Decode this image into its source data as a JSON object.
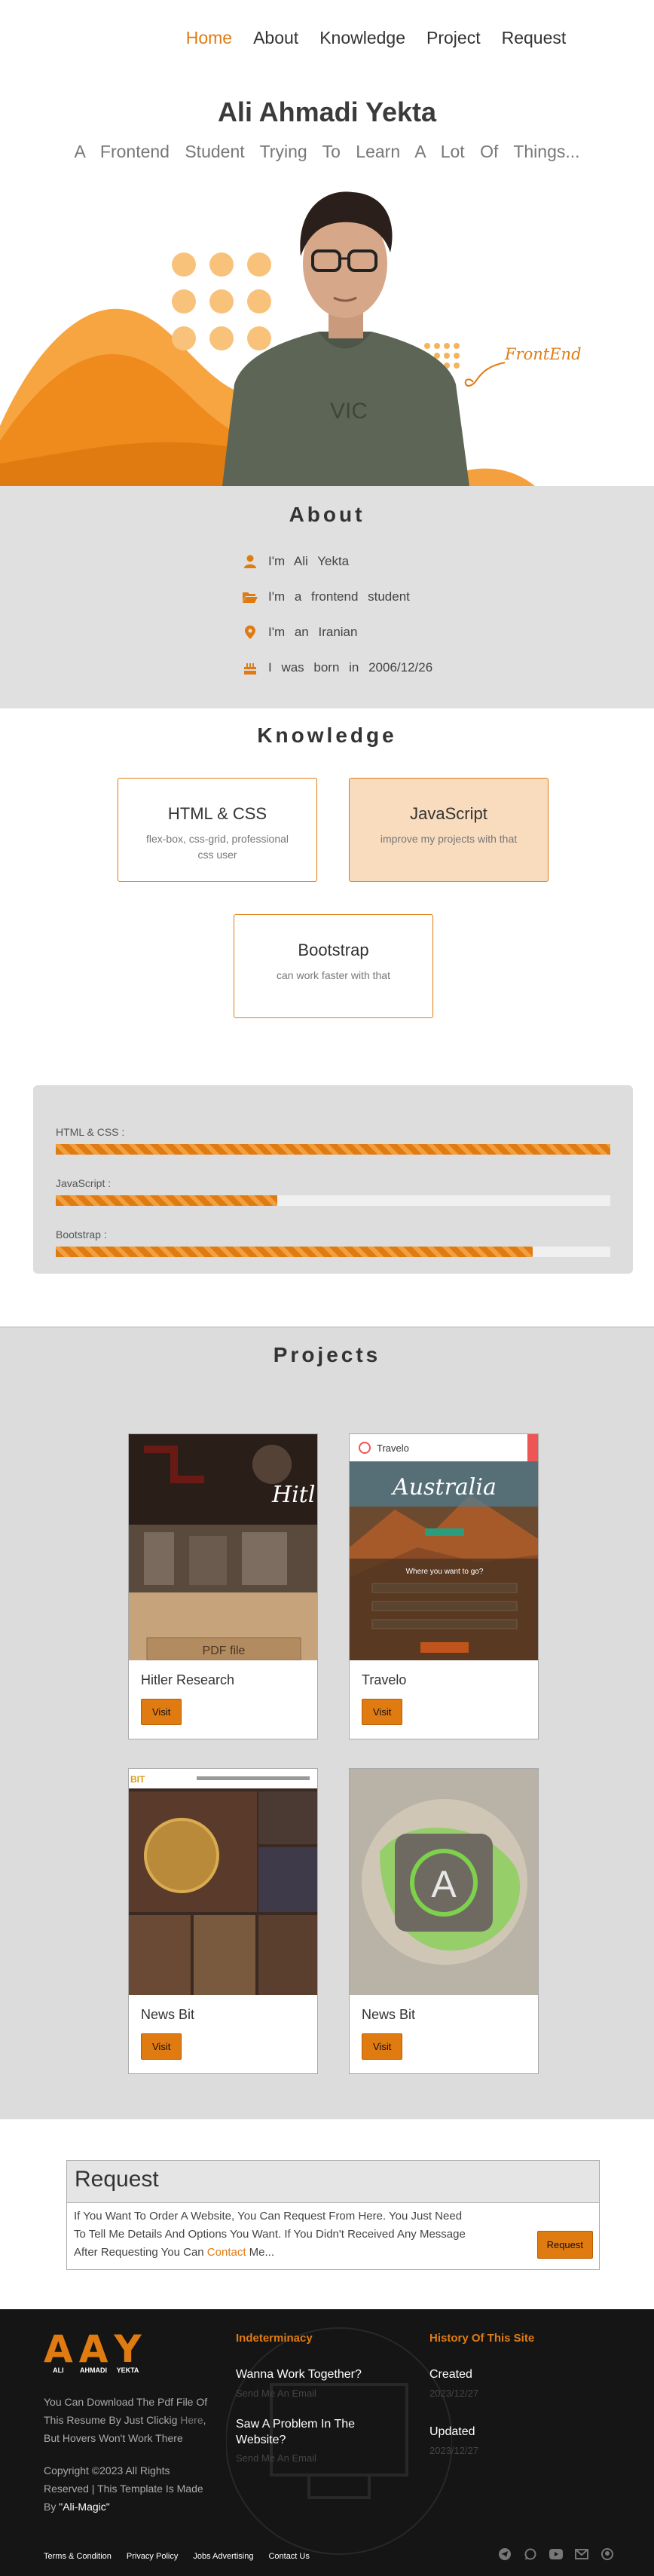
{
  "nav": {
    "items": [
      "Home",
      "About",
      "Knowledge",
      "Project",
      "Request"
    ],
    "active": "Home"
  },
  "hero": {
    "name": "Ali Ahmadi Yekta",
    "subtitle": "A Frontend Student Trying To Learn A Lot Of Things...",
    "tag": "FrontEnd",
    "sweater_text": "VIC"
  },
  "about": {
    "title": "About",
    "items": [
      {
        "icon": "user-icon",
        "text": "I'm Ali Yekta"
      },
      {
        "icon": "folder-open-icon",
        "text": "I'm a frontend student"
      },
      {
        "icon": "location-pin-icon",
        "text": "I'm an Iranian"
      },
      {
        "icon": "birthday-cake-icon",
        "text": "I was born in 2006/12/26"
      }
    ]
  },
  "knowledge": {
    "title": "Knowledge",
    "cards": [
      {
        "title": "HTML & CSS",
        "desc": "flex-box, css-grid, professional css user"
      },
      {
        "title": "JavaScript",
        "desc": "improve my projects with that"
      },
      {
        "title": "Bootstrap",
        "desc": "can work faster with that"
      }
    ],
    "skills": [
      {
        "label": "HTML & CSS :",
        "percent": 100
      },
      {
        "label": "JavaScript :",
        "percent": 40
      },
      {
        "label": "Bootstrap :",
        "percent": 86
      }
    ]
  },
  "projects": {
    "title": "Projects",
    "visit_label": "Visit",
    "items": [
      {
        "name": "Hitler Research",
        "img_text": "Hitl",
        "pdf_label": "PDF file"
      },
      {
        "name": "Travelo",
        "img_text": "Australia",
        "brand": "Travelo",
        "question": "Where you want to go?"
      },
      {
        "name": "News Bit",
        "img_text": "BIT"
      },
      {
        "name": "News Bit",
        "img_text": "A"
      }
    ]
  },
  "request": {
    "title": "Request",
    "text_before": "If You Want To Order A Website, You Can Request From Here. You Just Need To Tell Me Details And Options You Want. If You Didn't Received Any Message After Requesting You Can ",
    "contact": "Contact",
    "text_after": " Me...",
    "button": "Request"
  },
  "footer": {
    "logo_letters": [
      "A",
      "A",
      "Y"
    ],
    "logo_words": [
      "ALI",
      "AHMADI",
      "YEKTA"
    ],
    "download_before": "You Can Download The Pdf File Of This Resume By Just Clickig ",
    "download_here": "Here",
    "download_after": ", But Hovers Won't Work There",
    "copyright": "Copyright ©2023 All Rights Reserved | This Template Is Made By ",
    "author": "\"Ali-Magic\"",
    "col1": {
      "title": "Indeterminacy",
      "items": [
        {
          "q": "Wanna Work Together?",
          "s": "Send Me An Email"
        },
        {
          "q": "Saw A Problem In The Website?",
          "s": "Send Me An Email"
        }
      ]
    },
    "col2": {
      "title": "History Of This Site",
      "items": [
        {
          "q": "Created",
          "s": "2023/12/27"
        },
        {
          "q": "Updated",
          "s": "2023/12/27"
        }
      ]
    },
    "links": [
      "Terms & Condition",
      "Privacy Policy",
      "Jobs Advertising",
      "Contact Us"
    ],
    "social": [
      "telegram-icon",
      "whatsapp-icon",
      "youtube-icon",
      "mail-icon",
      "github-icon"
    ]
  },
  "colors": {
    "accent": "#e07b12",
    "light_accent": "#f9c27a",
    "section_bg": "#e0e0e0",
    "footer_bg": "#151515"
  }
}
